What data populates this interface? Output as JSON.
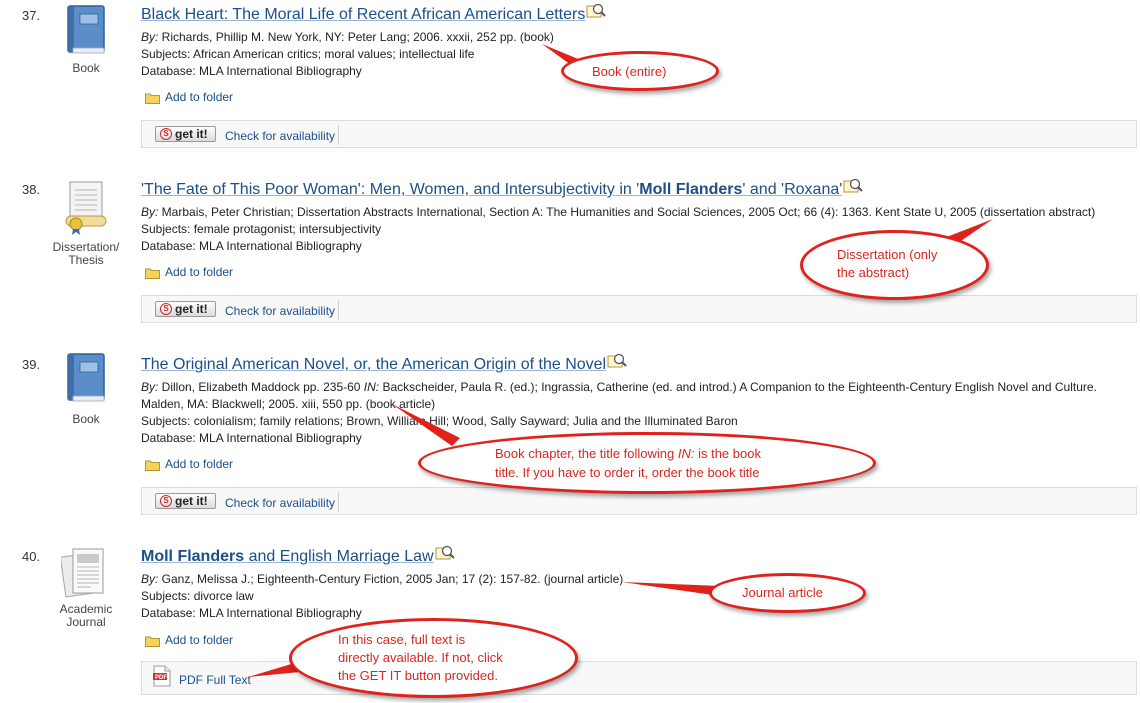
{
  "results": [
    {
      "number": "37.",
      "type_label": "Book",
      "title": "Black Heart: The Moral Life of Recent African American Letters",
      "by_label": "By:",
      "by_text": " Richards, Phillip M. New York, NY: Peter Lang; 2006. xxxii, 252 pp. (book)",
      "subjects": "Subjects: African American critics; moral values; intellectual life",
      "database": "Database: MLA International Bibliography",
      "add_to_folder": "Add to folder",
      "get_it": "get it!",
      "check_availability": "Check for availability"
    },
    {
      "number": "38.",
      "type_label_1": "Dissertation/",
      "type_label_2": "Thesis",
      "title_a": "'The Fate of This Poor Woman': Men, Women, and Intersubjectivity in '",
      "title_b": "Moll Flanders",
      "title_c": "' and 'Roxana'",
      "by_label": "By:",
      "by_text": " Marbais, Peter Christian; Dissertation Abstracts International, Section A: The Humanities and Social Sciences, 2005 Oct; 66 (4): 1363. Kent State U, 2005 (dissertation abstract)",
      "subjects": "Subjects: female protagonist; intersubjectivity",
      "database": "Database: MLA International Bibliography",
      "add_to_folder": "Add to folder",
      "get_it": "get it!",
      "check_availability": "Check for availability"
    },
    {
      "number": "39.",
      "type_label": "Book",
      "title": "The Original American Novel, or, the American Origin of the Novel",
      "by_label": "By:",
      "by_text_1": " Dillon, Elizabeth Maddock pp. 235-60 ",
      "in_label": "IN:",
      "by_text_2": " Backscheider, Paula R. (ed.); Ingrassia, Catherine (ed. and introd.) A Companion to the Eighteenth-Century English Novel and Culture. Malden, MA: Blackwell; 2005. xiii, 550 pp. (book article)",
      "subjects": "Subjects: colonialism; family relations; Brown, William Hill; Wood, Sally Sayward; Julia and the Illuminated Baron",
      "database": "Database: MLA International Bibliography",
      "add_to_folder": "Add to folder",
      "get_it": "get it!",
      "check_availability": "Check for availability"
    },
    {
      "number": "40.",
      "type_label_1": "Academic",
      "type_label_2": "Journal",
      "title_a": "Moll Flanders",
      "title_b": " and English Marriage Law",
      "by_label": "By:",
      "by_text": " Ganz, Melissa J.; Eighteenth-Century Fiction, 2005 Jan; 17 (2): 157-82. (journal article)",
      "subjects": "Subjects: divorce law",
      "database": "Database: MLA International Bibliography",
      "add_to_folder": "Add to folder",
      "pdf_full_text": "PDF Full Text"
    }
  ],
  "callouts": {
    "book": "Book (entire)",
    "dissertation_1": "Dissertation (only",
    "dissertation_2": "the abstract)",
    "chapter_1a": "Book chapter, the title following ",
    "chapter_1b": "IN:",
    "chapter_1c": " is the book",
    "chapter_2": "title. If you have to order it, order the book title",
    "journal": "Journal article",
    "fulltext_1": "In this case, full text is",
    "fulltext_2": "directly available. If not, click",
    "fulltext_3": "the GET IT button provided."
  },
  "colors": {
    "link": "#1a4f8a",
    "callout_red": "#e0211c"
  },
  "icons": [
    "book-icon",
    "dissertation-icon",
    "journal-icon",
    "preview-icon",
    "folder-icon",
    "sfx-icon",
    "pdf-icon"
  ]
}
